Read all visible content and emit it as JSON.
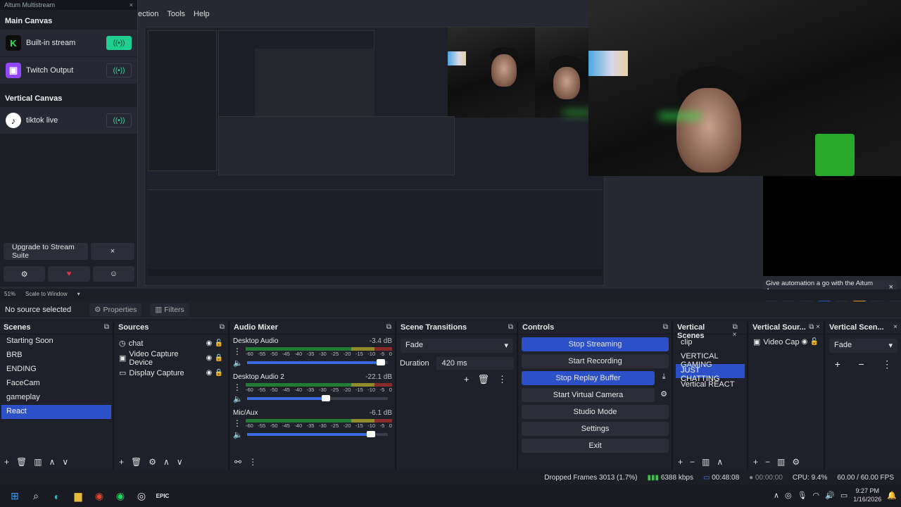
{
  "altum": {
    "title": "Altum Multistream",
    "close": "×",
    "main_canvas": "Main Canvas",
    "vertical_canvas": "Vertical Canvas",
    "destinations": [
      {
        "name": "Built-in stream",
        "logo": "K",
        "color": "#2ee55a",
        "on": true
      },
      {
        "name": "Twitch Output",
        "logo": "▣",
        "color": "#9146ff",
        "on": false
      },
      {
        "name": "tiktok live",
        "logo": "♪",
        "color": "#111111",
        "on": false
      }
    ],
    "upgrade": "Upgrade to Stream Suite",
    "upgrade_close": "×"
  },
  "menu": [
    "ection",
    "Tools",
    "Help"
  ],
  "automation": {
    "text": "Give automation a go with the Aitum App",
    "close": "×"
  },
  "zoom": {
    "percent": "51%",
    "mode": "Scale to Window"
  },
  "source_bar": {
    "none": "No source selected",
    "properties": "Properties",
    "filters": "Filters"
  },
  "docks": {
    "scenes": "Scenes",
    "sources": "Sources",
    "audio": "Audio Mixer",
    "transitions": "Scene Transitions",
    "controls": "Controls",
    "vscenes": "Vertical Scenes",
    "vsources": "Vertical Sour...",
    "vtrans": "Vertical Scen..."
  },
  "scenes": [
    "Starting Soon",
    "BRB",
    "ENDING",
    "FaceCam",
    "gameplay",
    "React"
  ],
  "sources": [
    {
      "name": "chat",
      "icon": "◷"
    },
    {
      "name": "Video Capture Device",
      "icon": "▣"
    },
    {
      "name": "Display Capture",
      "icon": "▭"
    }
  ],
  "mixer": [
    {
      "name": "Desktop Audio",
      "db": "-3.4 dB",
      "vol": 0.95
    },
    {
      "name": "Desktop Audio 2",
      "db": "-22.1 dB",
      "vol": 0.56
    },
    {
      "name": "Mic/Aux",
      "db": "-6.1 dB",
      "vol": 0.88
    }
  ],
  "scale": [
    "-60",
    "-55",
    "-50",
    "-45",
    "-40",
    "-35",
    "-30",
    "-25",
    "-20",
    "-15",
    "-10",
    "-5",
    "0"
  ],
  "transition": {
    "type": "Fade",
    "duration_label": "Duration",
    "duration": "420 ms"
  },
  "controls": [
    "Stop Streaming",
    "Start Recording",
    "Stop Replay Buffer",
    "Start Virtual Camera",
    "Studio Mode",
    "Settings",
    "Exit"
  ],
  "vscenes": [
    "clip",
    "VERTICAL GAMING",
    "JUST CHATTING",
    "Vertical REACT"
  ],
  "vsource": "Video Cap",
  "vtrans": "Fade",
  "status": {
    "dropped": "Dropped Frames 3013 (1.7%)",
    "kbps": "6388 kbps",
    "time1": "00:48:08",
    "time2": "00:00:00",
    "cpu": "CPU: 9.4%",
    "fps": "60.00 / 60.00 FPS"
  },
  "clock": {
    "time": "9:27 PM",
    "date": "1/16/2026"
  }
}
